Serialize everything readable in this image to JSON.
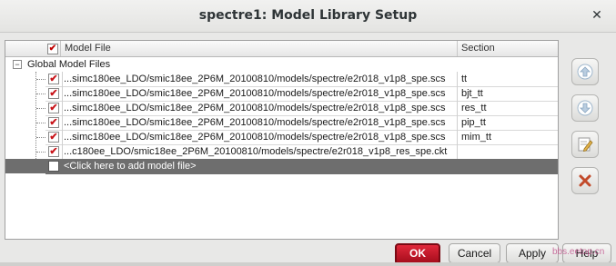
{
  "window": {
    "title": "spectre1: Model Library Setup",
    "close_glyph": "✕"
  },
  "table": {
    "columns": {
      "file": "Model File",
      "section": "Section"
    },
    "group_label": "Global Model Files",
    "group_expander": "−",
    "rows": [
      {
        "checked": true,
        "file": "...simc180ee_LDO/smic18ee_2P6M_20100810/models/spectre/e2r018_v1p8_spe.scs",
        "section": "tt"
      },
      {
        "checked": true,
        "file": "...simc180ee_LDO/smic18ee_2P6M_20100810/models/spectre/e2r018_v1p8_spe.scs",
        "section": "bjt_tt"
      },
      {
        "checked": true,
        "file": "...simc180ee_LDO/smic18ee_2P6M_20100810/models/spectre/e2r018_v1p8_spe.scs",
        "section": "res_tt"
      },
      {
        "checked": true,
        "file": "...simc180ee_LDO/smic18ee_2P6M_20100810/models/spectre/e2r018_v1p8_spe.scs",
        "section": "pip_tt"
      },
      {
        "checked": true,
        "file": "...simc180ee_LDO/smic18ee_2P6M_20100810/models/spectre/e2r018_v1p8_spe.scs",
        "section": "mim_tt"
      },
      {
        "checked": true,
        "file": "...c180ee_LDO/smic18ee_2P6M_20100810/models/spectre/e2r018_v1p8_res_spe.ckt",
        "section": ""
      }
    ],
    "add_row": {
      "file": "<Click here to add model file>",
      "section": ""
    },
    "check_glyph": "✔"
  },
  "side_buttons": [
    {
      "name": "move-up-icon"
    },
    {
      "name": "move-down-icon"
    },
    {
      "name": "edit-icon"
    },
    {
      "name": "delete-icon"
    }
  ],
  "buttons": {
    "ok": "OK",
    "cancel": "Cancel",
    "apply": "Apply",
    "help": "Help"
  },
  "watermark": "bbs.eetop.cn",
  "colors": {
    "ok_button": "#c8141a",
    "check": "#c8141a",
    "add_row_bg": "#6e6e6e"
  }
}
